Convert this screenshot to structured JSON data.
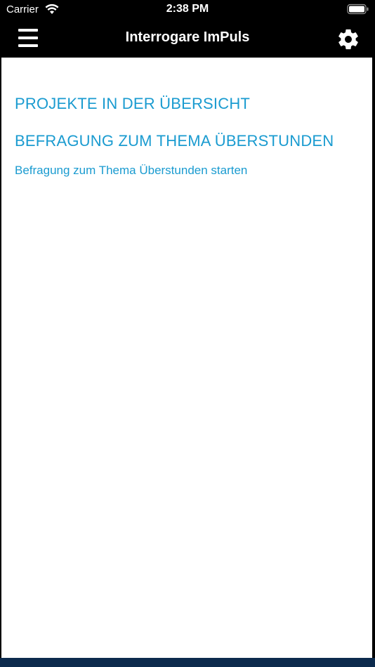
{
  "status_bar": {
    "carrier": "Carrier",
    "time": "2:38 PM",
    "icons": [
      "wifi-icon",
      "battery-icon"
    ]
  },
  "nav_bar": {
    "title": "Interrogare ImPuls",
    "left_icon": "menu-icon",
    "right_icon": "gear-icon"
  },
  "content": {
    "links": [
      {
        "label": "PROJEKTE IN DER ÜBERSICHT"
      },
      {
        "label": "BEFRAGUNG ZUM THEMA ÜBERSTUNDEN"
      },
      {
        "label": "Befragung zum Thema Überstunden starten"
      }
    ]
  },
  "colors": {
    "accent": "#1a9bd0",
    "nav_background": "#000000",
    "content_background": "#ffffff",
    "bottom_bar": "#0c2a4d"
  }
}
